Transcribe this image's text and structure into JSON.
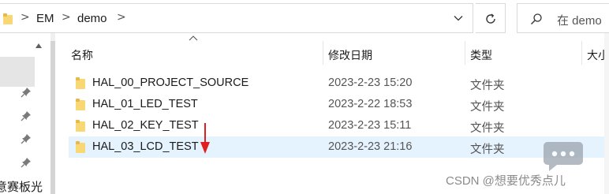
{
  "address_bar": {
    "breadcrumbs": [
      "EM",
      "demo"
    ],
    "separator": ">",
    "dropdown_icon": "chevron-down-icon",
    "refresh_icon": "refresh-icon"
  },
  "search": {
    "placeholder": "在 demo"
  },
  "nav_pane": {
    "partial_text": "意赛板光"
  },
  "columns": {
    "name": "名称",
    "date": "修改日期",
    "type": "类型",
    "size": "大小"
  },
  "files": [
    {
      "name": "HAL_00_PROJECT_SOURCE",
      "date": "2023-2-23 15:20",
      "type": "文件夹"
    },
    {
      "name": "HAL_01_LED_TEST",
      "date": "2023-2-22 18:53",
      "type": "文件夹"
    },
    {
      "name": "HAL_02_KEY_TEST",
      "date": "2023-2-23 15:11",
      "type": "文件夹"
    },
    {
      "name": "HAL_03_LCD_TEST",
      "date": "2023-2-23 21:16",
      "type": "文件夹"
    }
  ],
  "selected_row": 3,
  "watermark": {
    "text": "CSDN @想要优秀点儿"
  },
  "colors": {
    "folder": "#f8d775",
    "selection": "#e5f3ff",
    "annotation_arrow": "#e02020"
  }
}
